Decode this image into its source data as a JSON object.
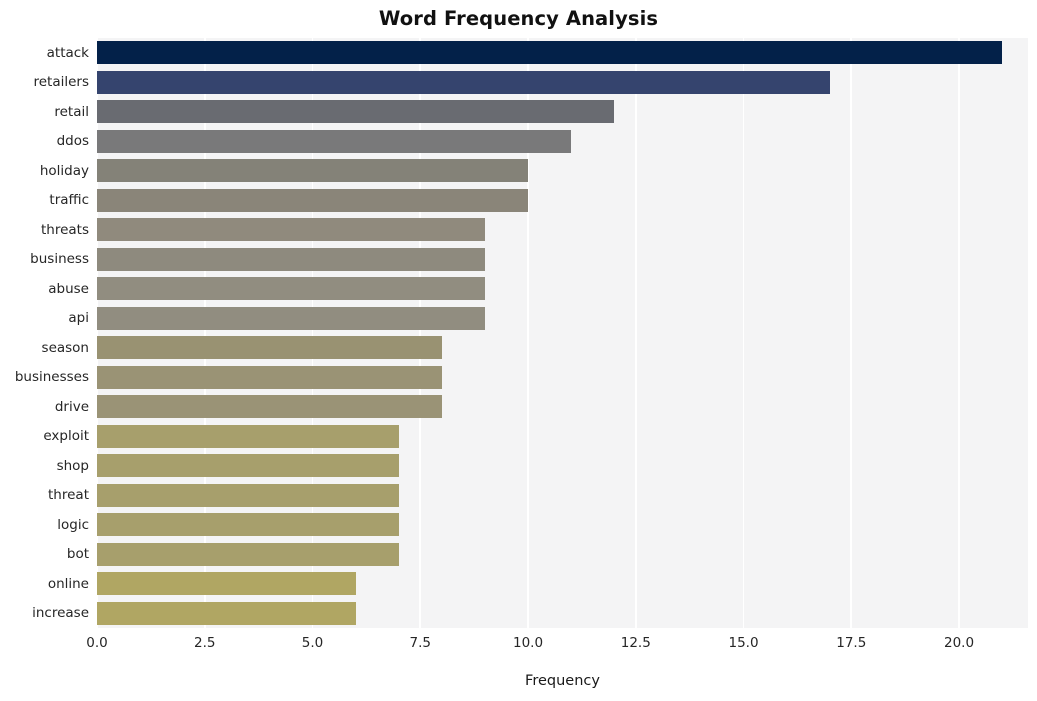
{
  "chart_data": {
    "type": "bar",
    "orientation": "horizontal",
    "title": "Word Frequency Analysis",
    "xlabel": "Frequency",
    "ylabel": "",
    "xlim": [
      0,
      21.6
    ],
    "ylim": [
      0,
      20
    ],
    "grid": true,
    "legend": false,
    "legend_position": "none",
    "style": "whitegrid",
    "xticks": [
      "0.0",
      "2.5",
      "5.0",
      "7.5",
      "10.0",
      "12.5",
      "15.0",
      "17.5",
      "20.0"
    ],
    "xtick_values": [
      0.0,
      2.5,
      5.0,
      7.5,
      10.0,
      12.5,
      15.0,
      17.5,
      20.0
    ],
    "categories": [
      "attack",
      "retailers",
      "retail",
      "ddos",
      "holiday",
      "traffic",
      "threats",
      "business",
      "abuse",
      "api",
      "season",
      "businesses",
      "drive",
      "exploit",
      "shop",
      "threat",
      "logic",
      "bot",
      "online",
      "increase"
    ],
    "values": [
      21,
      17,
      12,
      11,
      10,
      10,
      9,
      9,
      9,
      9,
      8,
      8,
      8,
      7,
      7,
      7,
      7,
      7,
      6,
      6
    ],
    "bar_colors": [
      "#032149",
      "#35446e",
      "#696b71",
      "#79797a",
      "#848278",
      "#8a8579",
      "#908a7d",
      "#8e8a7e",
      "#918d80",
      "#918d80",
      "#999272",
      "#9a9375",
      "#9a9376",
      "#a79f6c",
      "#a79f6c",
      "#a79f6c",
      "#a79f6c",
      "#a79f6c",
      "#b0a663",
      "#b0a663"
    ]
  },
  "colors": {
    "figure_background": "#ffffff",
    "plot_background": "#f4f4f5",
    "gridline": "#ffffff",
    "title_text": "#111111",
    "tick_text": "#262626",
    "axis_label_text": "#1a1a1a",
    "accent_darkest": "#032149",
    "accent_lightest": "#b0a663"
  }
}
